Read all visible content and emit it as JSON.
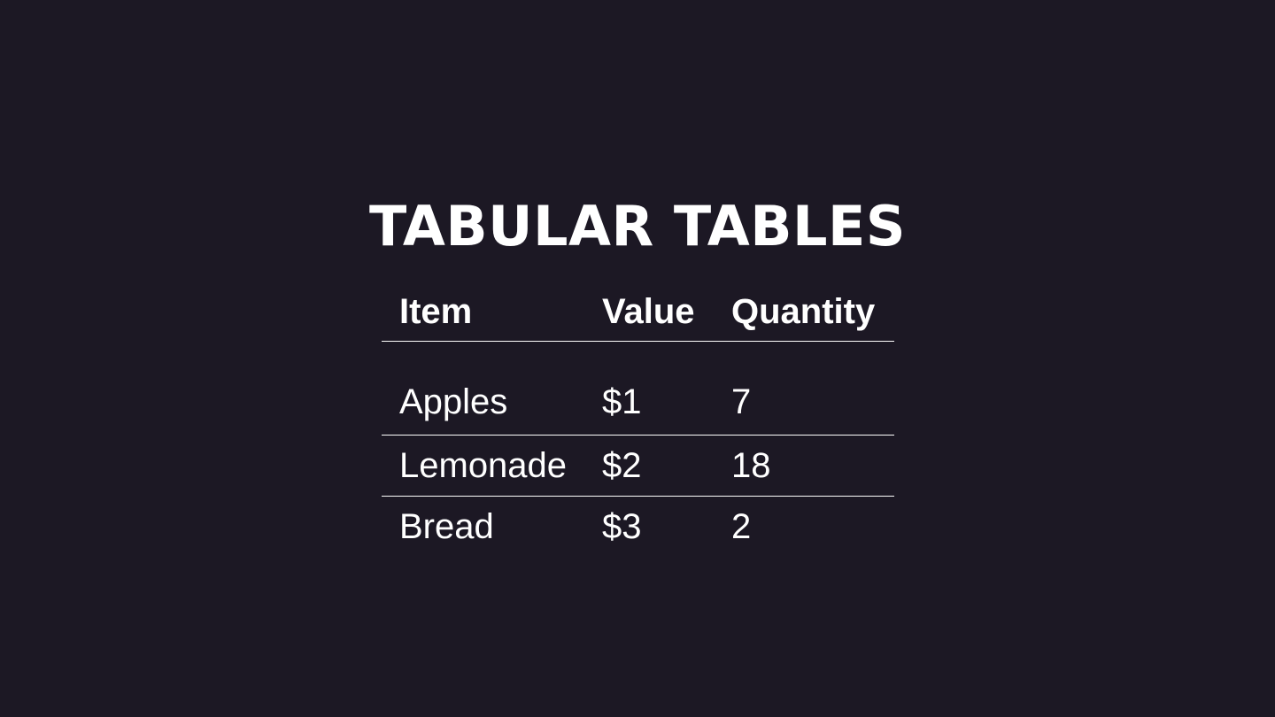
{
  "slide": {
    "title": "TABULAR TABLES",
    "background_color": "#1c1824",
    "text_color": "#ffffff"
  },
  "table": {
    "headers": [
      "Item",
      "Value",
      "Quantity"
    ],
    "rows": [
      [
        "Apples",
        "$1",
        "7"
      ],
      [
        "Lemonade",
        "$2",
        "18"
      ],
      [
        "Bread",
        "$3",
        "2"
      ]
    ]
  }
}
